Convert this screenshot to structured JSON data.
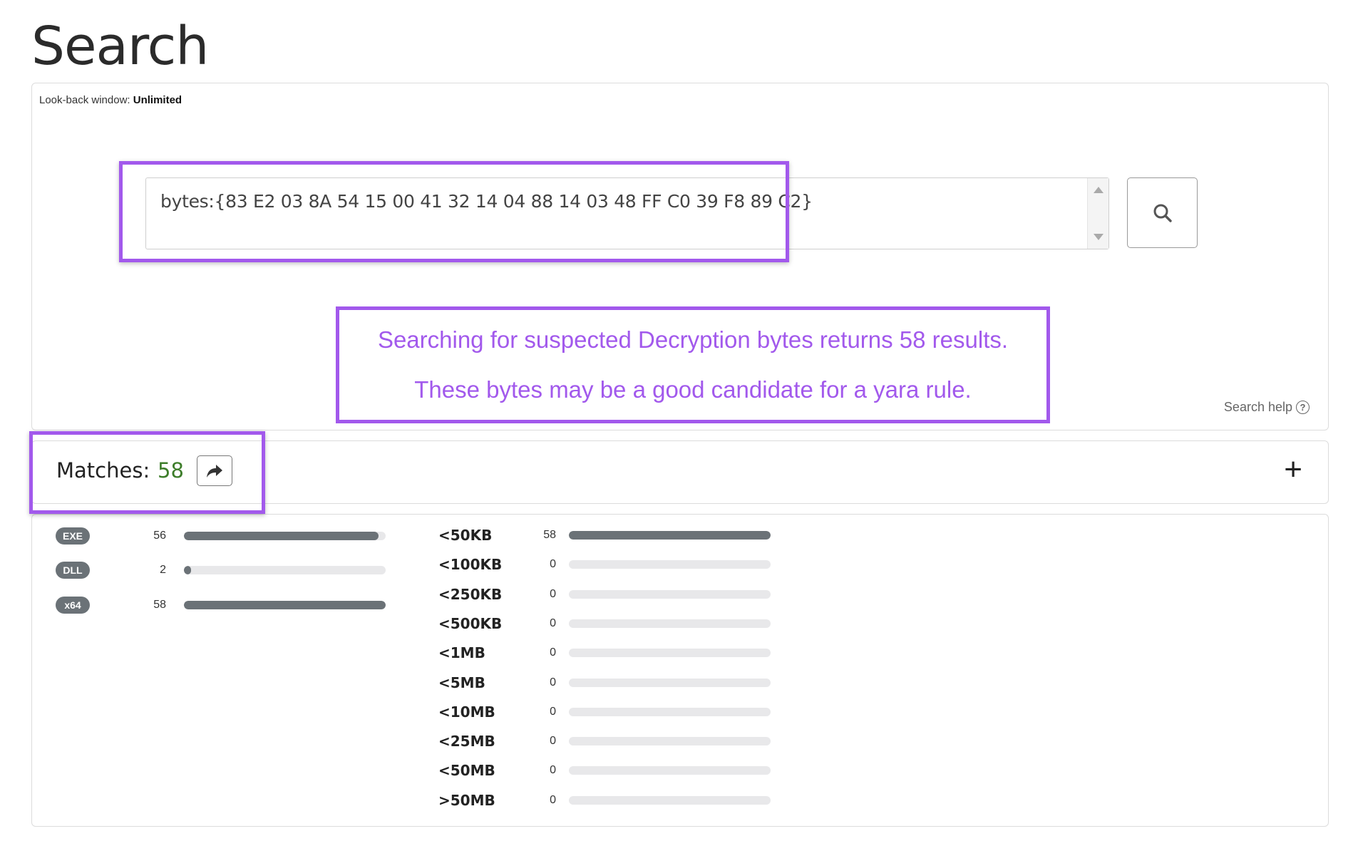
{
  "page": {
    "title": "Search"
  },
  "search": {
    "lookback_label": "Look-back window:",
    "lookback_value": "Unlimited",
    "query": "bytes:{83 E2 03 8A 54 15 00 41 32 14 04 88 14 03 48 FF C0 39 F8 89 C2}",
    "help_label": "Search help",
    "help_glyph": "?"
  },
  "annotation": {
    "line1": "Searching for suspected Decryption bytes returns 58 results.",
    "line2": "These bytes may be a good candidate for a yara rule.",
    "color": "#a259ec"
  },
  "matches": {
    "label": "Matches:",
    "count": "58",
    "expand_symbol": "+"
  },
  "file_types": [
    {
      "label": "EXE",
      "count": "56",
      "fraction": 0.966
    },
    {
      "label": "DLL",
      "count": "2",
      "fraction": 0.034
    },
    {
      "label": "x64",
      "count": "58",
      "fraction": 1.0
    }
  ],
  "sizes": [
    {
      "label": "<50KB",
      "count": "58",
      "fraction": 1.0
    },
    {
      "label": "<100KB",
      "count": "0",
      "fraction": 0
    },
    {
      "label": "<250KB",
      "count": "0",
      "fraction": 0
    },
    {
      "label": "<500KB",
      "count": "0",
      "fraction": 0
    },
    {
      "label": "<1MB",
      "count": "0",
      "fraction": 0
    },
    {
      "label": "<5MB",
      "count": "0",
      "fraction": 0
    },
    {
      "label": "<10MB",
      "count": "0",
      "fraction": 0
    },
    {
      "label": "<25MB",
      "count": "0",
      "fraction": 0
    },
    {
      "label": "<50MB",
      "count": "0",
      "fraction": 0
    },
    {
      "label": ">50MB",
      "count": "0",
      "fraction": 0
    }
  ],
  "colors": {
    "highlight": "#a259ec",
    "match_count": "#3d7d2a",
    "bar": "#6b7277",
    "bar_track": "#e8e8ea"
  }
}
